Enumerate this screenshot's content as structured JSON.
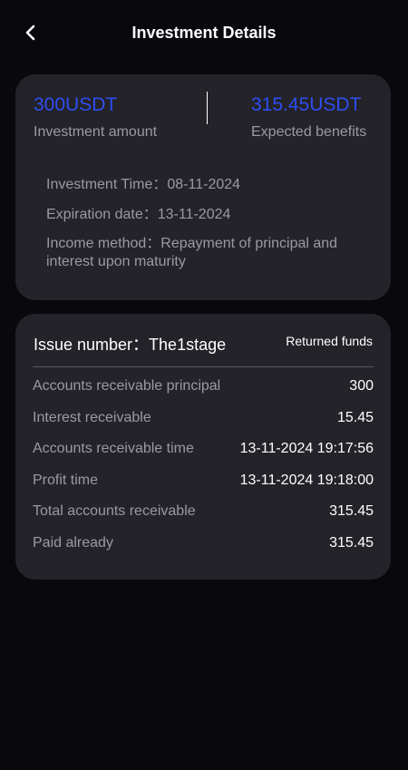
{
  "header": {
    "title": "Investment Details",
    "back_icon": "chevron-left-icon"
  },
  "summary": {
    "investment_amount": "300USDT",
    "investment_amount_label": "Investment amount",
    "expected_benefits": "315.45USDT",
    "expected_benefits_label": "Expected benefits",
    "investment_time": "Investment Time：08-11-2024",
    "expiration_date": "Expiration date：13-11-2024",
    "income_method": "Income method：Repayment of principal and interest upon maturity",
    "accent_color": "#2f4df2"
  },
  "issue": {
    "title": "Issue number：The1stage",
    "status": "Returned funds",
    "rows": [
      {
        "label": "Accounts receivable principal",
        "value": "300"
      },
      {
        "label": "Interest receivable",
        "value": "15.45"
      },
      {
        "label": "Accounts receivable time",
        "value": "13-11-2024 19:17:56"
      },
      {
        "label": "Profit time",
        "value": "13-11-2024 19:18:00"
      },
      {
        "label": "Total accounts receivable",
        "value": "315.45"
      },
      {
        "label": "Paid already",
        "value": "315.45"
      }
    ]
  }
}
